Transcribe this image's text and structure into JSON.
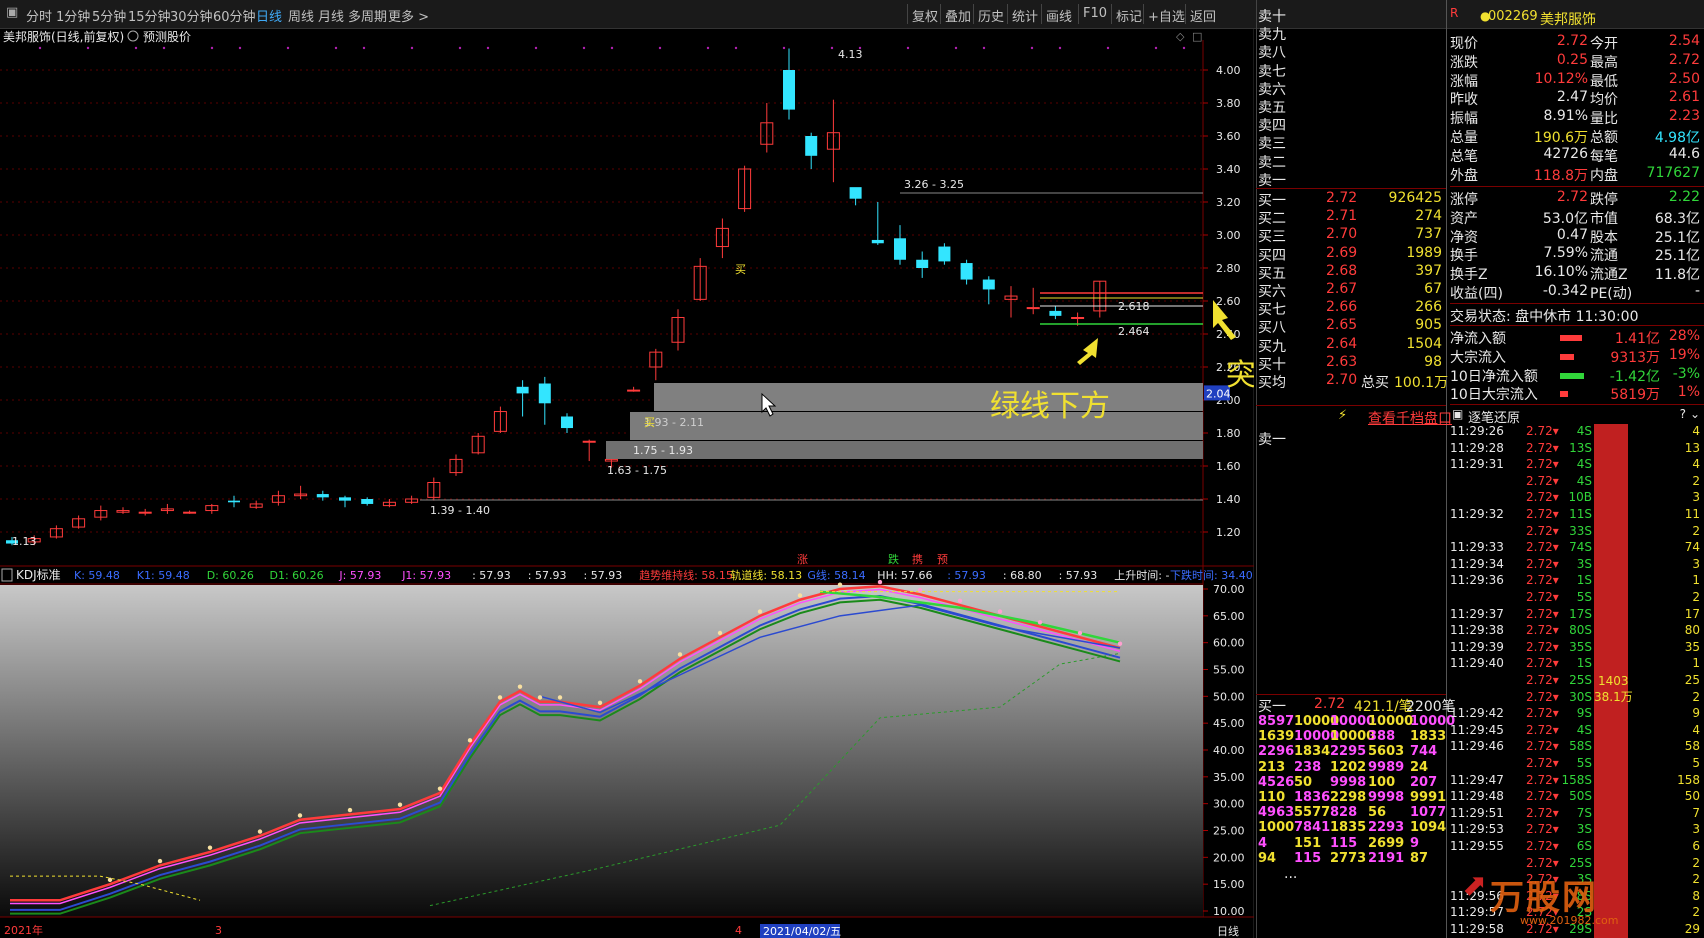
{
  "toolbar": {
    "left": [
      "分时",
      "1分钟",
      "5分钟",
      "15分钟",
      "30分钟",
      "60分钟",
      "日线",
      "周线",
      "月线",
      "多周期",
      "更多 >"
    ],
    "active": "日线",
    "right": [
      "复权",
      "叠加",
      "历史",
      "统计",
      "画线",
      "F10",
      "标记",
      "+自选",
      "返回"
    ]
  },
  "chart": {
    "title": "美邦服饰(日线,前复权)",
    "predict_label": "预测股价",
    "price_axis": [
      "4.00",
      "3.80",
      "3.60",
      "3.40",
      "3.20",
      "3.00",
      "2.80",
      "2.60",
      "2.40",
      "2.20",
      "2.00",
      "1.80",
      "1.60",
      "1.40",
      "1.20"
    ],
    "current_price_tag": "2.04",
    "high_label": "4.13",
    "low_label": "1.13",
    "zones": [
      "3.26 - 3.25",
      "1.93 - 2.11",
      "1.75 - 1.93",
      "1.63 - 1.75",
      "1.39 - 1.40"
    ],
    "zone_buy_prefix": "买",
    "line_labels": [
      "2.618",
      "2.464"
    ],
    "buy_marker": "买",
    "annotation_main": "突破红线涨停",
    "annotation_sub": "绿线下方",
    "signals": [
      "涨",
      "跌",
      "携",
      "预"
    ]
  },
  "kdj": {
    "title": "KDJ标准",
    "items": [
      {
        "t": "K: 59.48",
        "c": "#3b6cff"
      },
      {
        "t": "K1: 59.48",
        "c": "#3b6cff"
      },
      {
        "t": "D: 60.26",
        "c": "#31d63a"
      },
      {
        "t": "D1: 60.26",
        "c": "#31d63a"
      },
      {
        "t": "J: 57.93",
        "c": "#ff50ff"
      },
      {
        "t": "J1: 57.93",
        "c": "#ff50ff"
      },
      {
        "t": ": 57.93",
        "c": "#e8e8e8"
      },
      {
        "t": ": 57.93",
        "c": "#e8e8e8"
      },
      {
        "t": ": 57.93",
        "c": "#e8e8e8"
      },
      {
        "t": "趋势维持线: 58.15",
        "c": "#ff3b3b"
      },
      {
        "t": "轨道线: 58.13",
        "c": "#f0e030"
      },
      {
        "t": "G线: 58.14",
        "c": "#3b6cff"
      },
      {
        "t": "HH: 57.66",
        "c": "#e8e8e8"
      },
      {
        "t": ": 57.93",
        "c": "#3b6cff"
      },
      {
        "t": ": 68.80",
        "c": "#e8e8e8"
      },
      {
        "t": ": 57.93",
        "c": "#e8e8e8"
      },
      {
        "t": "上升时间: -",
        "c": "#e8e8e8"
      },
      {
        "t": "下跌时间: 34.40",
        "c": "#3b6cff"
      }
    ],
    "axis": [
      "70.00",
      "65.00",
      "60.00",
      "55.00",
      "50.00",
      "45.00",
      "40.00",
      "35.00",
      "30.00",
      "25.00",
      "20.00",
      "15.00",
      "10.00"
    ]
  },
  "date_axis": {
    "labels": [
      "2021年",
      "3",
      "4"
    ],
    "cursor_date": "2021/04/02/五",
    "period": "日线"
  },
  "quote": {
    "code": "002269",
    "name": "美邦服饰",
    "rows": [
      [
        "现价",
        "2.72",
        "今开",
        "2.54"
      ],
      [
        "涨跌",
        "0.25",
        "最高",
        "2.72"
      ],
      [
        "涨幅",
        "10.12%",
        "最低",
        "2.50"
      ],
      [
        "昨收",
        "2.47",
        "均价",
        "2.61"
      ],
      [
        "振幅",
        "8.91%",
        "量比",
        "2.23"
      ],
      [
        "总量",
        "190.6万",
        "总额",
        "4.98亿"
      ],
      [
        "总笔",
        "42726",
        "每笔",
        "44.6"
      ],
      [
        "外盘",
        "118.8万",
        "内盘",
        "717627"
      ]
    ],
    "rows2": [
      [
        "涨停",
        "2.72",
        "跌停",
        "2.22"
      ],
      [
        "资产",
        "53.0亿",
        "市值",
        "68.3亿"
      ],
      [
        "净资",
        "0.47",
        "股本",
        "25.1亿"
      ],
      [
        "换手",
        "7.59%",
        "流通",
        "25.1亿"
      ],
      [
        "换手Z",
        "16.10%",
        "流通Z",
        "11.8亿"
      ],
      [
        "收益(四)",
        "-0.342",
        "PE(动)",
        "-"
      ]
    ],
    "status": "交易状态: 盘中休市 11:30:00",
    "flows": [
      [
        "净流入额",
        "1.41亿",
        "28%"
      ],
      [
        "大宗流入",
        "9313万",
        "19%"
      ],
      [
        "10日净流入额",
        "-1.42亿",
        "-3%"
      ],
      [
        "10日大宗流入",
        "5819万",
        "1%"
      ]
    ]
  },
  "orderbook": {
    "sells": [
      "卖十",
      "卖九",
      "卖八",
      "卖七",
      "卖六",
      "卖五",
      "卖四",
      "卖三",
      "卖二",
      "卖一"
    ],
    "buys": [
      [
        "买一",
        "2.72",
        "926425"
      ],
      [
        "买二",
        "2.71",
        "274"
      ],
      [
        "买三",
        "2.70",
        "737"
      ],
      [
        "买四",
        "2.69",
        "1989"
      ],
      [
        "买五",
        "2.68",
        "397"
      ],
      [
        "买六",
        "2.67",
        "67"
      ],
      [
        "买七",
        "2.66",
        "266"
      ],
      [
        "买八",
        "2.65",
        "905"
      ],
      [
        "买九",
        "2.64",
        "1504"
      ],
      [
        "买十",
        "2.63",
        "98"
      ]
    ],
    "avg": [
      "买均",
      "2.70",
      "总买",
      "100.1万"
    ],
    "link": "查看千档盘口",
    "sell1": "卖一",
    "buy1_summary": [
      "买一",
      "2.72",
      "421.1/笔",
      "2200笔"
    ],
    "queue": [
      [
        "8597",
        "10000",
        "10000",
        "10000",
        "10000"
      ],
      [
        "1639",
        "10000",
        "10000",
        "388",
        "1833"
      ],
      [
        "2296",
        "1834",
        "2295",
        "5603",
        "744"
      ],
      [
        "213",
        "238",
        "1202",
        "9989",
        "24"
      ],
      [
        "4526",
        "50",
        "9998",
        "100",
        "207"
      ],
      [
        "110",
        "1836",
        "2298",
        "9998",
        "9991"
      ],
      [
        "4963",
        "5577",
        "828",
        "56",
        "1077"
      ],
      [
        "1000",
        "7841",
        "1835",
        "2293",
        "1094"
      ],
      [
        "4",
        "151",
        "115",
        "2699",
        "9"
      ],
      [
        "94",
        "115",
        "2773",
        "2191",
        "87"
      ]
    ],
    "queue_more": "..."
  },
  "ticks": {
    "title": "逐笔还原",
    "bar_label1": "1403",
    "bar_label2": "38.1万",
    "rows": [
      [
        "11:29:26",
        "2.72",
        "4S",
        "4"
      ],
      [
        "11:29:28",
        "2.72",
        "13S",
        "13"
      ],
      [
        "11:29:31",
        "2.72",
        "4S",
        "4"
      ],
      [
        "",
        "2.72",
        "4S",
        "2"
      ],
      [
        "",
        "2.72",
        "10B",
        "3"
      ],
      [
        "11:29:32",
        "2.72",
        "11S",
        "11"
      ],
      [
        "",
        "2.72",
        "33S",
        "2"
      ],
      [
        "11:29:33",
        "2.72",
        "74S",
        "74"
      ],
      [
        "11:29:34",
        "2.72",
        "3S",
        "3"
      ],
      [
        "11:29:36",
        "2.72",
        "1S",
        "1"
      ],
      [
        "",
        "2.72",
        "5S",
        "2"
      ],
      [
        "11:29:37",
        "2.72",
        "17S",
        "17"
      ],
      [
        "11:29:38",
        "2.72",
        "80S",
        "80"
      ],
      [
        "11:29:39",
        "2.72",
        "35S",
        "35"
      ],
      [
        "11:29:40",
        "2.72",
        "1S",
        "1"
      ],
      [
        "",
        "2.72",
        "25S",
        "25"
      ],
      [
        "",
        "2.72",
        "30S",
        "2"
      ],
      [
        "11:29:42",
        "2.72",
        "9S",
        "9"
      ],
      [
        "11:29:45",
        "2.72",
        "4S",
        "4"
      ],
      [
        "11:29:46",
        "2.72",
        "58S",
        "58"
      ],
      [
        "",
        "2.72",
        "5S",
        "5"
      ],
      [
        "11:29:47",
        "2.72",
        "158S",
        "158"
      ],
      [
        "11:29:48",
        "2.72",
        "50S",
        "50"
      ],
      [
        "11:29:51",
        "2.72",
        "7S",
        "7"
      ],
      [
        "11:29:53",
        "2.72",
        "3S",
        "3"
      ],
      [
        "11:29:55",
        "2.72",
        "6S",
        "6"
      ],
      [
        "",
        "2.72",
        "25S",
        "2"
      ],
      [
        "",
        "2.72",
        "3S",
        "2"
      ],
      [
        "11:29:56",
        "2.72",
        "8S",
        "8"
      ],
      [
        "11:29:57",
        "2.72",
        "2S",
        "2"
      ],
      [
        "11:29:58",
        "2.72",
        "29S",
        "29"
      ]
    ]
  },
  "watermark": {
    "text": "万股网",
    "url": "www.201982.com"
  },
  "colors": {
    "up": "#ff3b3b",
    "down": "#33e5ff",
    "bg": "#000000",
    "grid": "#7a0000",
    "green": "#31d63a",
    "yellow": "#f0e030",
    "magenta": "#ff50ff",
    "blue": "#3b6cff"
  }
}
